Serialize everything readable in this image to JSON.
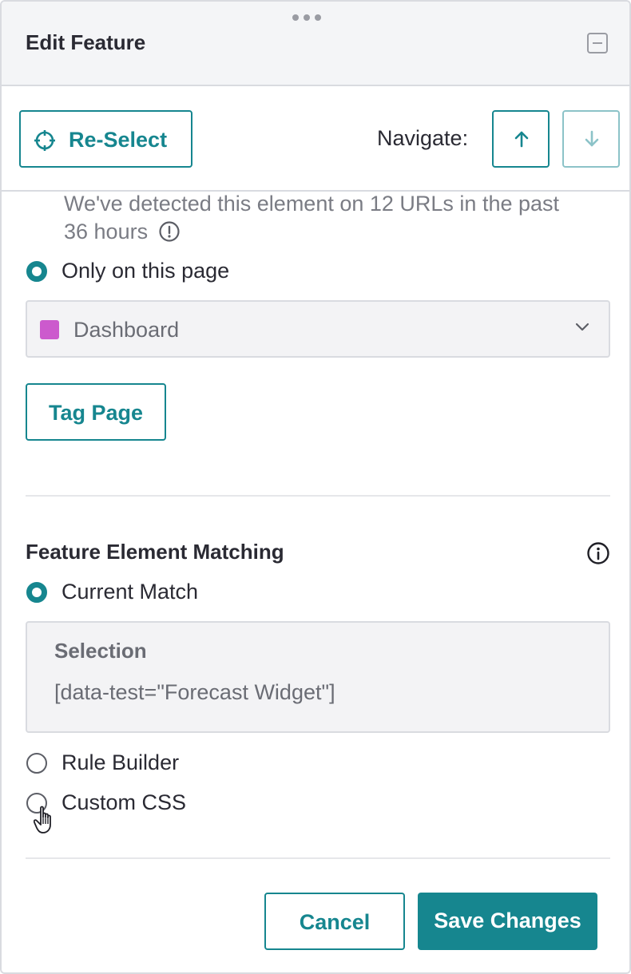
{
  "header": {
    "title": "Edit Feature"
  },
  "toolbar": {
    "reselect_label": "Re-Select",
    "navigate_label": "Navigate:"
  },
  "detection": {
    "text": "We've detected this element on 12 URLs in the past 36 hours"
  },
  "page_scope": {
    "option_only_this_page": "Only on this page",
    "selected_page": "Dashboard",
    "selected_page_color": "#cc5acd",
    "tag_page_label": "Tag Page"
  },
  "matching": {
    "title": "Feature Element Matching",
    "options": [
      {
        "label": "Current Match",
        "checked": true
      },
      {
        "label": "Rule Builder",
        "checked": false
      },
      {
        "label": "Custom CSS",
        "checked": false
      }
    ],
    "selection_title": "Selection",
    "selection_value": "[data-test=\"Forecast Widget\"]"
  },
  "footer": {
    "cancel_label": "Cancel",
    "save_label": "Save Changes"
  },
  "colors": {
    "accent": "#16868f",
    "border": "#d9dbe0",
    "muted_text": "#7a7c84"
  }
}
